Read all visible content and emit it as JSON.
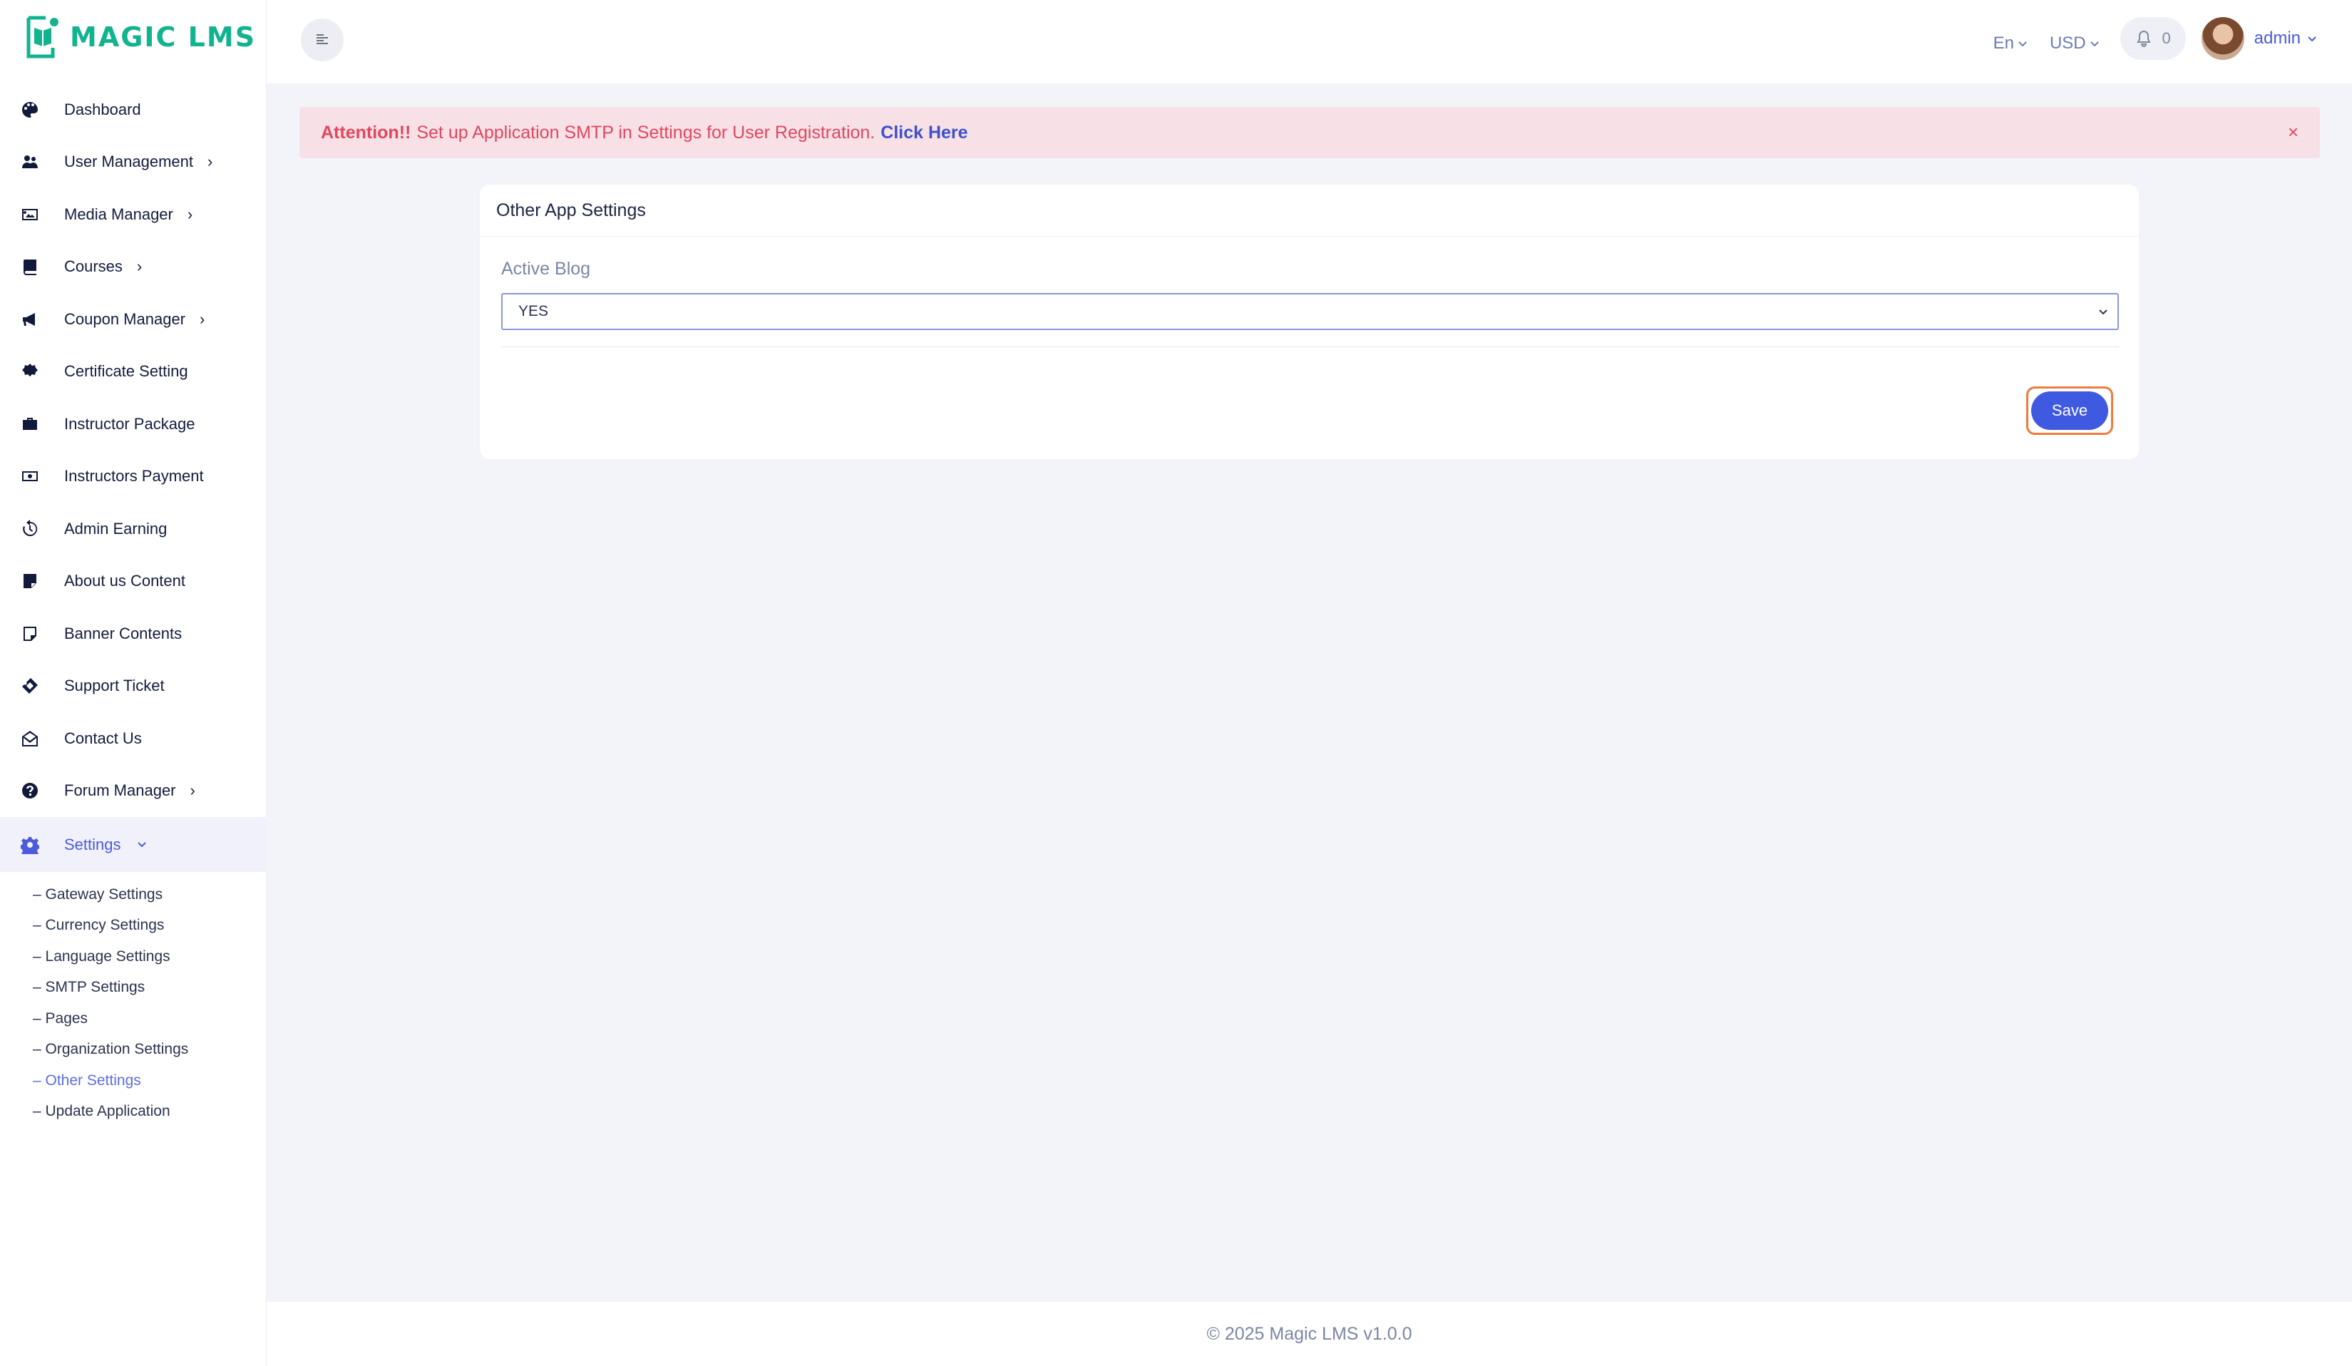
{
  "brand": {
    "name": "MAGIC LMS",
    "color": "#12b38f",
    "accent": "#4b5bd9"
  },
  "header": {
    "language": "En",
    "currency": "USD",
    "notification_count": "0",
    "username": "admin"
  },
  "sidebar": {
    "items": [
      {
        "label": "Dashboard",
        "icon": "palette-icon",
        "has_children": false
      },
      {
        "label": "User Management",
        "icon": "users-icon",
        "has_children": true
      },
      {
        "label": "Media Manager",
        "icon": "image-icon",
        "has_children": true
      },
      {
        "label": "Courses",
        "icon": "book-icon",
        "has_children": true
      },
      {
        "label": "Coupon Manager",
        "icon": "megaphone-icon",
        "has_children": true
      },
      {
        "label": "Certificate Setting",
        "icon": "certificate-icon",
        "has_children": false
      },
      {
        "label": "Instructor Package",
        "icon": "briefcase-icon",
        "has_children": false
      },
      {
        "label": "Instructors Payment",
        "icon": "money-icon",
        "has_children": false
      },
      {
        "label": "Admin Earning",
        "icon": "history-icon",
        "has_children": false
      },
      {
        "label": "About us Content",
        "icon": "note-icon",
        "has_children": false
      },
      {
        "label": "Banner Contents",
        "icon": "sticky-note-icon",
        "has_children": false
      },
      {
        "label": "Support Ticket",
        "icon": "ticket-icon",
        "has_children": false
      },
      {
        "label": "Contact Us",
        "icon": "envelope-open-icon",
        "has_children": false
      },
      {
        "label": "Forum Manager",
        "icon": "question-circle-icon",
        "has_children": true
      },
      {
        "label": "Settings",
        "icon": "gear-icon",
        "has_children": true,
        "active": true
      }
    ],
    "settings_submenu": [
      "– Gateway Settings",
      "– Currency Settings",
      "– Language Settings",
      "– SMTP Settings",
      "– Pages",
      "– Organization Settings",
      "– Other Settings",
      "– Update Application"
    ],
    "current_submenu": "– Other Settings"
  },
  "alert": {
    "prefix": "Attention!!",
    "message": "Set up Application SMTP in Settings for User Registration.",
    "link": "Click Here",
    "close": "×"
  },
  "card": {
    "title": "Other App Settings",
    "field_label": "Active Blog",
    "select_value": "YES",
    "save_label": "Save"
  },
  "footer": {
    "text": "© 2025 Magic LMS v1.0.0"
  }
}
